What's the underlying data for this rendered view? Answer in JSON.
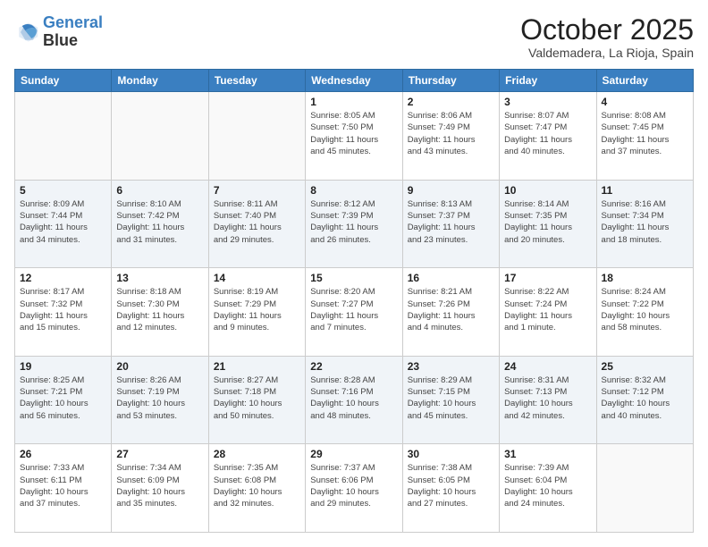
{
  "header": {
    "logo_line1": "General",
    "logo_line2": "Blue",
    "month": "October 2025",
    "location": "Valdemadera, La Rioja, Spain"
  },
  "weekdays": [
    "Sunday",
    "Monday",
    "Tuesday",
    "Wednesday",
    "Thursday",
    "Friday",
    "Saturday"
  ],
  "weeks": [
    [
      {
        "day": "",
        "info": ""
      },
      {
        "day": "",
        "info": ""
      },
      {
        "day": "",
        "info": ""
      },
      {
        "day": "1",
        "info": "Sunrise: 8:05 AM\nSunset: 7:50 PM\nDaylight: 11 hours\nand 45 minutes."
      },
      {
        "day": "2",
        "info": "Sunrise: 8:06 AM\nSunset: 7:49 PM\nDaylight: 11 hours\nand 43 minutes."
      },
      {
        "day": "3",
        "info": "Sunrise: 8:07 AM\nSunset: 7:47 PM\nDaylight: 11 hours\nand 40 minutes."
      },
      {
        "day": "4",
        "info": "Sunrise: 8:08 AM\nSunset: 7:45 PM\nDaylight: 11 hours\nand 37 minutes."
      }
    ],
    [
      {
        "day": "5",
        "info": "Sunrise: 8:09 AM\nSunset: 7:44 PM\nDaylight: 11 hours\nand 34 minutes."
      },
      {
        "day": "6",
        "info": "Sunrise: 8:10 AM\nSunset: 7:42 PM\nDaylight: 11 hours\nand 31 minutes."
      },
      {
        "day": "7",
        "info": "Sunrise: 8:11 AM\nSunset: 7:40 PM\nDaylight: 11 hours\nand 29 minutes."
      },
      {
        "day": "8",
        "info": "Sunrise: 8:12 AM\nSunset: 7:39 PM\nDaylight: 11 hours\nand 26 minutes."
      },
      {
        "day": "9",
        "info": "Sunrise: 8:13 AM\nSunset: 7:37 PM\nDaylight: 11 hours\nand 23 minutes."
      },
      {
        "day": "10",
        "info": "Sunrise: 8:14 AM\nSunset: 7:35 PM\nDaylight: 11 hours\nand 20 minutes."
      },
      {
        "day": "11",
        "info": "Sunrise: 8:16 AM\nSunset: 7:34 PM\nDaylight: 11 hours\nand 18 minutes."
      }
    ],
    [
      {
        "day": "12",
        "info": "Sunrise: 8:17 AM\nSunset: 7:32 PM\nDaylight: 11 hours\nand 15 minutes."
      },
      {
        "day": "13",
        "info": "Sunrise: 8:18 AM\nSunset: 7:30 PM\nDaylight: 11 hours\nand 12 minutes."
      },
      {
        "day": "14",
        "info": "Sunrise: 8:19 AM\nSunset: 7:29 PM\nDaylight: 11 hours\nand 9 minutes."
      },
      {
        "day": "15",
        "info": "Sunrise: 8:20 AM\nSunset: 7:27 PM\nDaylight: 11 hours\nand 7 minutes."
      },
      {
        "day": "16",
        "info": "Sunrise: 8:21 AM\nSunset: 7:26 PM\nDaylight: 11 hours\nand 4 minutes."
      },
      {
        "day": "17",
        "info": "Sunrise: 8:22 AM\nSunset: 7:24 PM\nDaylight: 11 hours\nand 1 minute."
      },
      {
        "day": "18",
        "info": "Sunrise: 8:24 AM\nSunset: 7:22 PM\nDaylight: 10 hours\nand 58 minutes."
      }
    ],
    [
      {
        "day": "19",
        "info": "Sunrise: 8:25 AM\nSunset: 7:21 PM\nDaylight: 10 hours\nand 56 minutes."
      },
      {
        "day": "20",
        "info": "Sunrise: 8:26 AM\nSunset: 7:19 PM\nDaylight: 10 hours\nand 53 minutes."
      },
      {
        "day": "21",
        "info": "Sunrise: 8:27 AM\nSunset: 7:18 PM\nDaylight: 10 hours\nand 50 minutes."
      },
      {
        "day": "22",
        "info": "Sunrise: 8:28 AM\nSunset: 7:16 PM\nDaylight: 10 hours\nand 48 minutes."
      },
      {
        "day": "23",
        "info": "Sunrise: 8:29 AM\nSunset: 7:15 PM\nDaylight: 10 hours\nand 45 minutes."
      },
      {
        "day": "24",
        "info": "Sunrise: 8:31 AM\nSunset: 7:13 PM\nDaylight: 10 hours\nand 42 minutes."
      },
      {
        "day": "25",
        "info": "Sunrise: 8:32 AM\nSunset: 7:12 PM\nDaylight: 10 hours\nand 40 minutes."
      }
    ],
    [
      {
        "day": "26",
        "info": "Sunrise: 7:33 AM\nSunset: 6:11 PM\nDaylight: 10 hours\nand 37 minutes."
      },
      {
        "day": "27",
        "info": "Sunrise: 7:34 AM\nSunset: 6:09 PM\nDaylight: 10 hours\nand 35 minutes."
      },
      {
        "day": "28",
        "info": "Sunrise: 7:35 AM\nSunset: 6:08 PM\nDaylight: 10 hours\nand 32 minutes."
      },
      {
        "day": "29",
        "info": "Sunrise: 7:37 AM\nSunset: 6:06 PM\nDaylight: 10 hours\nand 29 minutes."
      },
      {
        "day": "30",
        "info": "Sunrise: 7:38 AM\nSunset: 6:05 PM\nDaylight: 10 hours\nand 27 minutes."
      },
      {
        "day": "31",
        "info": "Sunrise: 7:39 AM\nSunset: 6:04 PM\nDaylight: 10 hours\nand 24 minutes."
      },
      {
        "day": "",
        "info": ""
      }
    ]
  ]
}
